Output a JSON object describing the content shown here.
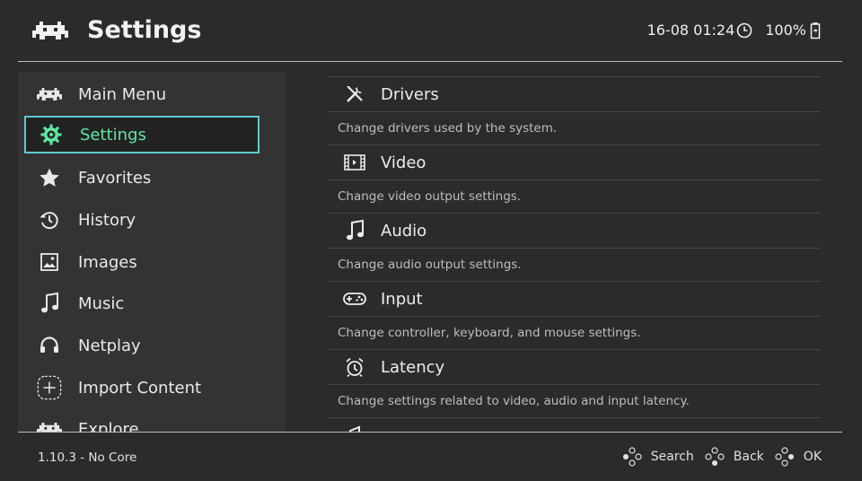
{
  "header": {
    "title": "Settings",
    "datetime": "16-08 01:24",
    "battery": "100%"
  },
  "sidebar": {
    "items": [
      {
        "label": "Main Menu",
        "icon": "invader-icon"
      },
      {
        "label": "Settings",
        "icon": "gear-icon",
        "selected": true
      },
      {
        "label": "Favorites",
        "icon": "star-icon"
      },
      {
        "label": "History",
        "icon": "history-icon"
      },
      {
        "label": "Images",
        "icon": "image-icon"
      },
      {
        "label": "Music",
        "icon": "music-note-icon"
      },
      {
        "label": "Netplay",
        "icon": "headset-icon"
      },
      {
        "label": "Import Content",
        "icon": "plus-icon"
      },
      {
        "label": "Explore",
        "icon": "invader-icon"
      }
    ]
  },
  "content": {
    "entries": [
      {
        "label": "Drivers",
        "desc": "Change drivers used by the system.",
        "icon": "tools-icon"
      },
      {
        "label": "Video",
        "desc": "Change video output settings.",
        "icon": "film-icon"
      },
      {
        "label": "Audio",
        "desc": "Change audio output settings.",
        "icon": "music-note-icon"
      },
      {
        "label": "Input",
        "desc": "Change controller, keyboard, and mouse settings.",
        "icon": "gamepad-icon"
      },
      {
        "label": "Latency",
        "desc": "Change settings related to video, audio and input latency.",
        "icon": "alarm-clock-icon"
      }
    ]
  },
  "footer": {
    "version": "1.10.3 - No Core",
    "hints": [
      "Search",
      "Back",
      "OK"
    ]
  },
  "colors": {
    "background": "#2b2b2b",
    "sidebar": "#333333",
    "selection_border": "#5ec9d0",
    "selection_text": "#5fe7a1"
  }
}
